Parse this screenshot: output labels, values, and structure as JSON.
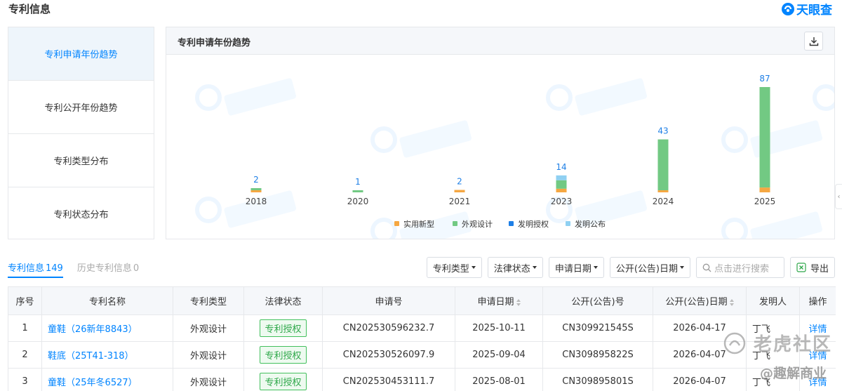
{
  "header": {
    "title": "专利信息",
    "brand": "天眼查"
  },
  "sidebar": {
    "items": [
      {
        "label": "专利申请年份趋势",
        "active": true
      },
      {
        "label": "专利公开年份趋势",
        "active": false
      },
      {
        "label": "专利类型分布",
        "active": false
      },
      {
        "label": "专利状态分布",
        "active": false
      }
    ]
  },
  "chart_panel": {
    "title": "专利申请年份趋势",
    "download_icon": "download-icon"
  },
  "chart_data": {
    "type": "bar",
    "stacked": true,
    "categories": [
      "2018",
      "2020",
      "2021",
      "2023",
      "2024",
      "2025"
    ],
    "totals": [
      2,
      1,
      2,
      14,
      43,
      87
    ],
    "series": [
      {
        "name": "实用新型",
        "color": "#f5a742",
        "values": [
          1,
          0,
          2,
          3,
          1,
          4
        ]
      },
      {
        "name": "外观设计",
        "color": "#72c983",
        "values": [
          1,
          1,
          0,
          7,
          42,
          83
        ]
      },
      {
        "name": "发明授权",
        "color": "#1e7fe6",
        "values": [
          0,
          0,
          0,
          0,
          0,
          0
        ]
      },
      {
        "name": "发明公布",
        "color": "#8fd0f2",
        "values": [
          0,
          0,
          0,
          4,
          0,
          0
        ]
      }
    ],
    "legend_position": "bottom-center",
    "grid": false
  },
  "tabs": [
    {
      "label": "专利信息",
      "count": "149",
      "active": true
    },
    {
      "label": "历史专利信息",
      "count": "0",
      "active": false
    }
  ],
  "filters": {
    "type": "专利类型",
    "status": "法律状态",
    "apply_date": "申请日期",
    "pub_date": "公开(公告)日期",
    "search_placeholder": "点击进行搜索",
    "export": "导出"
  },
  "table": {
    "headers": [
      "序号",
      "专利名称",
      "专利类型",
      "法律状态",
      "申请号",
      "申请日期",
      "公开(公告)号",
      "公开(公告)日期",
      "发明人",
      "操作"
    ],
    "rows": [
      {
        "no": "1",
        "name": "童鞋（26新年8843）",
        "type": "外观设计",
        "status": "专利授权",
        "app_no": "CN202530596232.7",
        "app_date": "2025-10-11",
        "pub_no": "CN309921545S",
        "pub_date": "2026-04-17",
        "inventor": "丁飞",
        "op": "详情"
      },
      {
        "no": "2",
        "name": "鞋底（25T41-318）",
        "type": "外观设计",
        "status": "专利授权",
        "app_no": "CN202530526097.9",
        "app_date": "2025-09-04",
        "pub_no": "CN309895822S",
        "pub_date": "2026-04-07",
        "inventor": "丁飞",
        "op": "详情"
      },
      {
        "no": "3",
        "name": "童鞋（25年冬6527）",
        "type": "外观设计",
        "status": "专利授权",
        "app_no": "CN202530453111.7",
        "app_date": "2025-08-01",
        "pub_no": "CN309895801S",
        "pub_date": "2026-04-07",
        "inventor": "丁飞",
        "op": "详情"
      }
    ]
  },
  "watermarks": {
    "overlay_top": "老虎社区",
    "overlay_bottom": "@趣解商业"
  }
}
